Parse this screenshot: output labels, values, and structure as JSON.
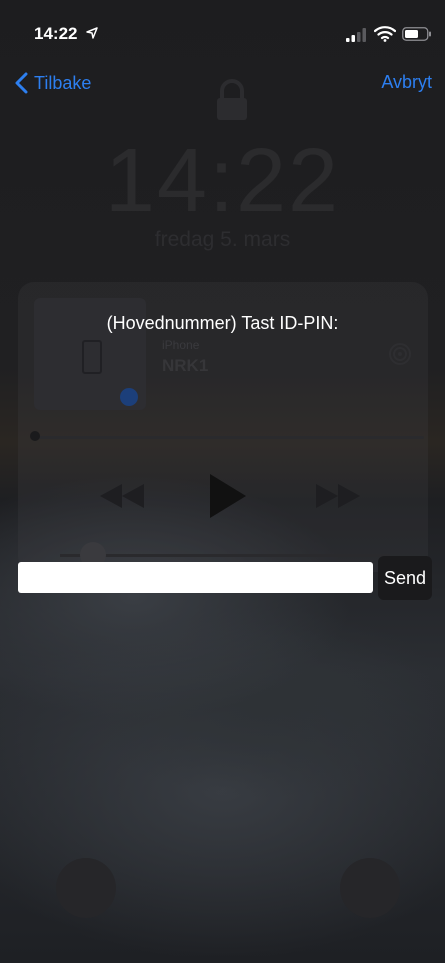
{
  "status_bar": {
    "time": "14:22",
    "icons": [
      "location-arrow-icon",
      "signal-icon",
      "wifi-icon",
      "battery-icon"
    ]
  },
  "nav": {
    "back_label": "Tilbake",
    "cancel_label": "Avbryt",
    "accent_color": "#2d7ff0"
  },
  "background": {
    "lock_time": "14:22",
    "lock_date": "fredag 5. mars",
    "now_playing_source": "iPhone",
    "now_playing_title": "NRK1"
  },
  "dialog": {
    "prompt": "(Hovednummer) Tast ID-PIN:",
    "pin_value": "",
    "send_label": "Send"
  }
}
